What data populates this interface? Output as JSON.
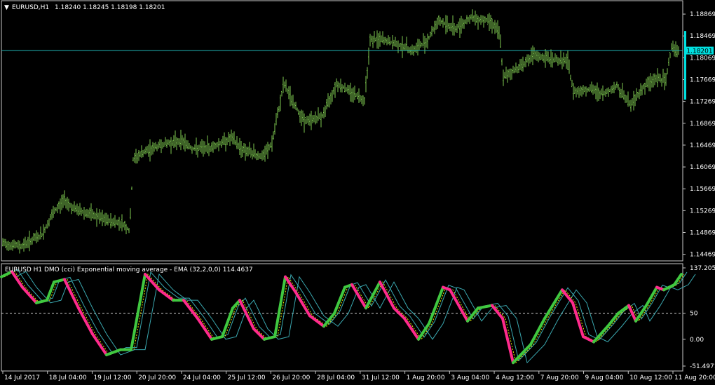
{
  "main_chart": {
    "header_arrow": "▼",
    "symbol": "EURUSD,H1",
    "ohlc": "1.18240 1.18245 1.18198 1.18201",
    "price_ticks": [
      "1.18869",
      "1.18469",
      "1.18069",
      "1.17669",
      "1.17269",
      "1.16869",
      "1.16469",
      "1.16069",
      "1.15669",
      "1.15269",
      "1.14869",
      "1.14469"
    ],
    "current_price": "1.18201",
    "bar_color": "#7ec850",
    "line_color": "#20b0b0",
    "current_label_bg": "#00e0e0"
  },
  "indicator": {
    "title": "EURUSD H1 DMO (cci) Exponential moving average - EMA (32,2,0,0) 114.4637",
    "scale_ticks": [
      "137.2054",
      "50",
      "0.00",
      "-51.4971"
    ],
    "up_color": "#40c840",
    "down_color": "#ff2a8c",
    "signal_color": "#e8e800",
    "band_color": "#3aa8b0"
  },
  "time_axis": [
    "14 Jul 2017",
    "18 Jul 04:00",
    "19 Jul 12:00",
    "20 Jul 20:00",
    "24 Jul 04:00",
    "25 Jul 12:00",
    "26 Jul 20:00",
    "28 Jul 04:00",
    "31 Jul 12:00",
    "1 Aug 20:00",
    "3 Aug 04:00",
    "4 Aug 12:00",
    "7 Aug 20:00",
    "9 Aug 04:00",
    "10 Aug 12:00",
    "11 Aug 20:00"
  ],
  "chart_data": [
    {
      "type": "bar",
      "title": "EURUSD,H1",
      "ylim": [
        1.144,
        1.1905
      ],
      "close_path": [
        [
          0,
          1.1467
        ],
        [
          30,
          1.1462
        ],
        [
          60,
          1.1483
        ],
        [
          75,
          1.152
        ],
        [
          92,
          1.1548
        ],
        [
          105,
          1.153
        ],
        [
          125,
          1.1522
        ],
        [
          150,
          1.151
        ],
        [
          175,
          1.1503
        ],
        [
          185,
          1.149
        ],
        [
          190,
          1.162
        ],
        [
          200,
          1.163
        ],
        [
          230,
          1.1648
        ],
        [
          260,
          1.1655
        ],
        [
          275,
          1.164
        ],
        [
          300,
          1.1642
        ],
        [
          330,
          1.166
        ],
        [
          345,
          1.164
        ],
        [
          375,
          1.1625
        ],
        [
          388,
          1.165
        ],
        [
          405,
          1.176
        ],
        [
          420,
          1.172
        ],
        [
          435,
          1.169
        ],
        [
          460,
          1.17
        ],
        [
          480,
          1.176
        ],
        [
          500,
          1.1745
        ],
        [
          520,
          1.173
        ],
        [
          528,
          1.184
        ],
        [
          545,
          1.184
        ],
        [
          570,
          1.183
        ],
        [
          590,
          1.182
        ],
        [
          610,
          1.184
        ],
        [
          625,
          1.1875
        ],
        [
          650,
          1.186
        ],
        [
          670,
          1.188
        ],
        [
          700,
          1.1875
        ],
        [
          713,
          1.185
        ],
        [
          718,
          1.177
        ],
        [
          740,
          1.179
        ],
        [
          760,
          1.181
        ],
        [
          785,
          1.1805
        ],
        [
          810,
          1.18
        ],
        [
          818,
          1.1745
        ],
        [
          840,
          1.175
        ],
        [
          860,
          1.174
        ],
        [
          880,
          1.1755
        ],
        [
          900,
          1.172
        ],
        [
          915,
          1.175
        ],
        [
          935,
          1.177
        ],
        [
          950,
          1.1765
        ],
        [
          958,
          1.183
        ],
        [
          966,
          1.182
        ]
      ]
    },
    {
      "type": "line",
      "title": "EURUSD H1 DMO (cci) Exponential moving average - EMA (32,2,0,0) 114.4637",
      "ylim": [
        -51.4971,
        137.2054
      ],
      "series": [
        {
          "values": [
            [
              0,
              120
            ],
            [
              15,
              130
            ],
            [
              30,
              100
            ],
            [
              50,
              70
            ],
            [
              65,
              75
            ],
            [
              75,
              110
            ],
            [
              90,
              115
            ],
            [
              110,
              60
            ],
            [
              130,
              10
            ],
            [
              150,
              -30
            ],
            [
              170,
              -20
            ],
            [
              185,
              -20
            ],
            [
              205,
              125
            ],
            [
              225,
              95
            ],
            [
              245,
              75
            ],
            [
              260,
              75
            ],
            [
              280,
              40
            ],
            [
              300,
              0
            ],
            [
              315,
              5
            ],
            [
              330,
              60
            ],
            [
              340,
              75
            ],
            [
              360,
              20
            ],
            [
              375,
              0
            ],
            [
              390,
              5
            ],
            [
              405,
              120
            ],
            [
              420,
              90
            ],
            [
              440,
              45
            ],
            [
              460,
              25
            ],
            [
              475,
              50
            ],
            [
              490,
              100
            ],
            [
              500,
              105
            ],
            [
              520,
              60
            ],
            [
              540,
              110
            ],
            [
              560,
              60
            ],
            [
              575,
              40
            ],
            [
              595,
              0
            ],
            [
              610,
              30
            ],
            [
              630,
              100
            ],
            [
              640,
              95
            ],
            [
              665,
              35
            ],
            [
              680,
              60
            ],
            [
              700,
              65
            ],
            [
              715,
              40
            ],
            [
              730,
              -45
            ],
            [
              755,
              -10
            ],
            [
              775,
              40
            ],
            [
              800,
              95
            ],
            [
              815,
              70
            ],
            [
              830,
              5
            ],
            [
              845,
              -5
            ],
            [
              865,
              25
            ],
            [
              880,
              50
            ],
            [
              895,
              65
            ],
            [
              905,
              35
            ],
            [
              920,
              65
            ],
            [
              935,
              100
            ],
            [
              945,
              95
            ],
            [
              960,
              105
            ],
            [
              970,
              125
            ]
          ]
        }
      ],
      "reference_line": 50
    }
  ]
}
